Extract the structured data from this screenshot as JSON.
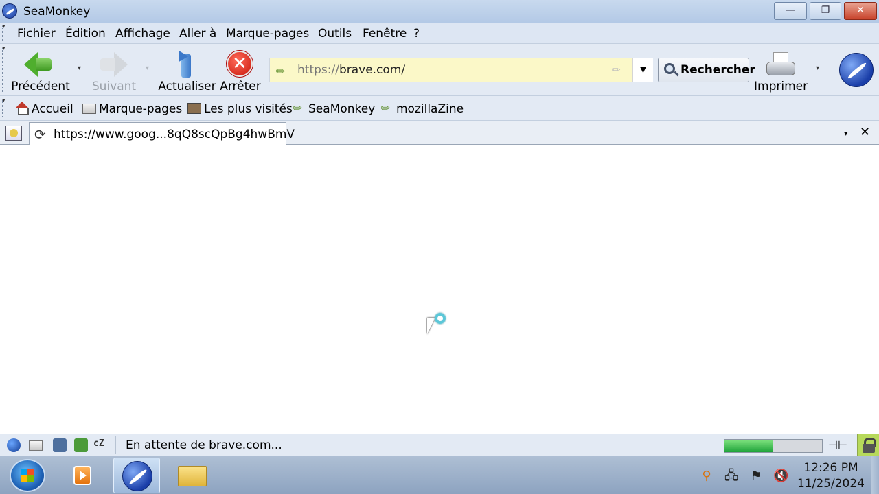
{
  "window": {
    "title": "SeaMonkey",
    "minimize_glyph": "—",
    "maximize_glyph": "❐",
    "close_glyph": "✕"
  },
  "menubar": {
    "items": [
      "Fichier",
      "Édition",
      "Affichage",
      "Aller à",
      "Marque-pages",
      "Outils",
      "Fenêtre",
      "?"
    ]
  },
  "navbar": {
    "back_label": "Précédent",
    "forward_label": "Suivant",
    "reload_label": "Actualiser",
    "stop_label": "Arrêter",
    "stop_glyph": "✕",
    "url_scheme": "https://",
    "url_host": "brave.com/",
    "url_dropdown_glyph": "▼",
    "search_label": "Rechercher",
    "print_label": "Imprimer",
    "dropdown_glyph": "▾"
  },
  "bookmarks": {
    "items": [
      "Accueil",
      "Marque-pages",
      "Les plus visités",
      "SeaMonkey",
      "mozillaZine"
    ]
  },
  "tabs": {
    "active_title": "https://www.goog...8qQ8scQpBg4hwBmV",
    "spinner_glyph": "⟳",
    "list_glyph": "▾",
    "close_glyph": "✕"
  },
  "status": {
    "text": "En attente de brave.com...",
    "progress_fraction": 0.49,
    "progress_color": "#2fb34a",
    "chat_label": "cZ",
    "plug_glyph": "⊣⊢"
  },
  "taskbar": {
    "clock_time": "12:26 PM",
    "clock_date": "11/25/2024",
    "tray_icons": [
      "search-icon",
      "network-icon",
      "flag-icon",
      "volume-muted-icon"
    ]
  },
  "colors": {
    "url_bar_bg": "#fbf8c8",
    "stop_red": "#d0150a",
    "back_green": "#4fae2e"
  }
}
